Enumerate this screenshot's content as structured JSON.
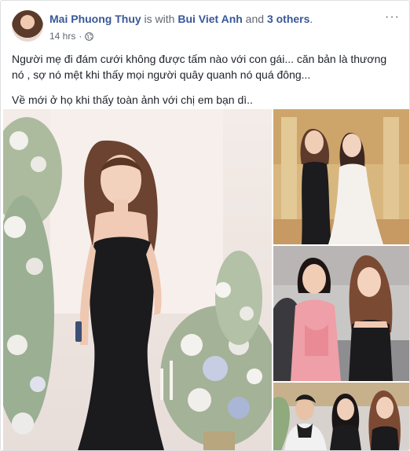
{
  "post": {
    "author": "Mai Phuong Thuy",
    "with_text": " is with ",
    "tagged": "Bui Viet Anh",
    "and_text": " and ",
    "others": "3 others",
    "period": ".",
    "time": "14 hrs",
    "dot": "·",
    "privacy_icon": "globe-icon",
    "more_icon": "more-options-icon",
    "more_glyph": "···",
    "text_line1": "Người mẹ đi đám cưới không được tấm nào với con gái... căn bản là thương nó , sợ nó mệt khi thấy mọi người quây quanh nó quá đông...",
    "text_line2": "Về mới ở họ khi thấy toàn ảnh với chị em bạn dì.."
  },
  "photos": [
    {
      "name": "photo-main"
    },
    {
      "name": "photo-right-1"
    },
    {
      "name": "photo-right-2"
    },
    {
      "name": "photo-right-3"
    }
  ],
  "colors": {
    "link": "#385898",
    "meta": "#616770",
    "text": "#1d2129",
    "border": "#dddfe2"
  }
}
